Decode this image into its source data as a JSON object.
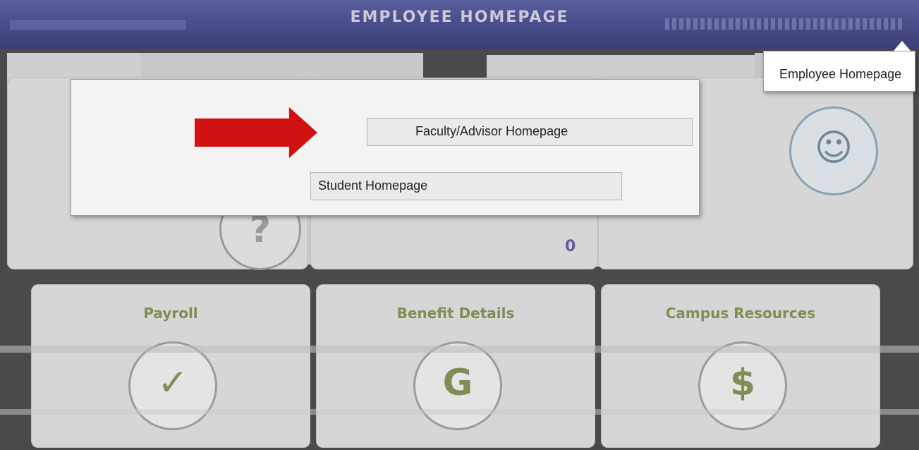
{
  "header": {
    "title": "EMPLOYEE HOMEPAGE"
  },
  "homepage_menu": {
    "items": [
      {
        "label": "Faculty/Advisor Homepage"
      },
      {
        "label": "Student Homepage"
      },
      {
        "label": "Employee Homepage"
      }
    ]
  },
  "tiles": [
    {
      "label": "Payroll",
      "icon": "payroll-icon"
    },
    {
      "label": "Benefit Details",
      "icon": "g-logo-icon"
    },
    {
      "label": "Campus Resources",
      "icon": "dollar-icon"
    }
  ],
  "counter": {
    "value": "0"
  },
  "colors": {
    "banner": "#4b4f8c",
    "tile_label": "#7d8f55",
    "arrow": "#d11212",
    "counter": "#6a5aa8"
  }
}
